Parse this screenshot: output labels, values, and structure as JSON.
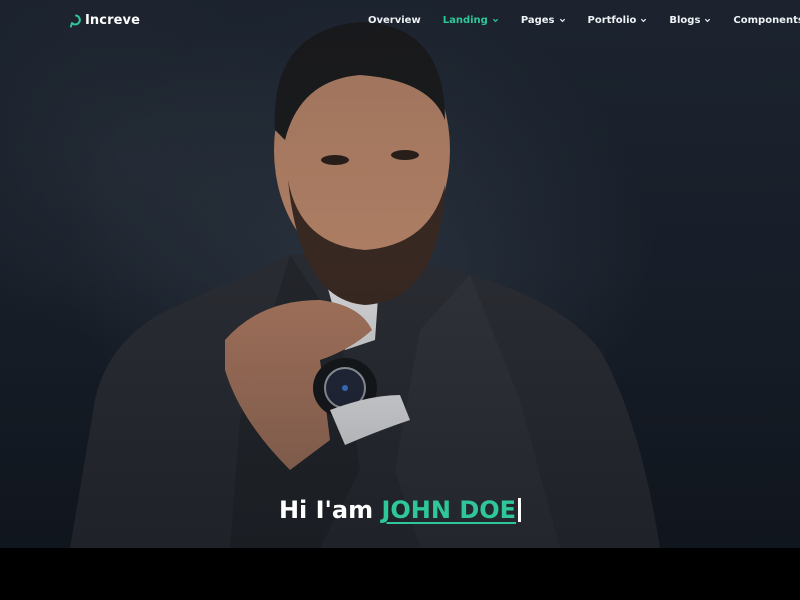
{
  "brand": {
    "name": "Increve",
    "logo_icon": "ring-logo-icon",
    "accent": "#2fc79a"
  },
  "nav": {
    "items": [
      {
        "label": "Overview",
        "dropdown": false,
        "active": false
      },
      {
        "label": "Landing",
        "dropdown": true,
        "active": true
      },
      {
        "label": "Pages",
        "dropdown": true,
        "active": false
      },
      {
        "label": "Portfolio",
        "dropdown": true,
        "active": false
      },
      {
        "label": "Blogs",
        "dropdown": true,
        "active": false
      },
      {
        "label": "Components",
        "dropdown": false,
        "active": false
      }
    ]
  },
  "hero": {
    "greeting": "Hi I'am",
    "name": "JOHN DOE",
    "image": "man-in-suit-portrait-photo"
  }
}
